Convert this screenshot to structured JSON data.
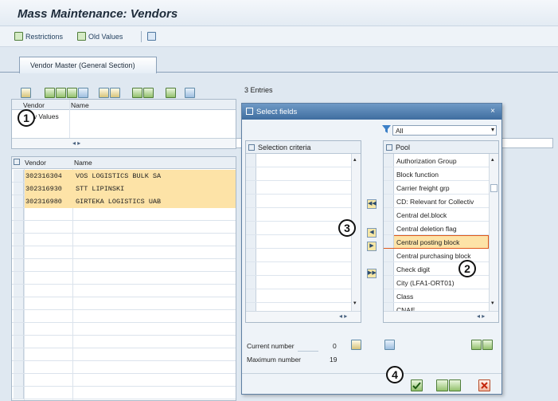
{
  "window": {
    "title": "Mass Maintenance: Vendors"
  },
  "toolbar": {
    "restrictions": "Restrictions",
    "old_values": "Old Values"
  },
  "tabs": [
    {
      "label": "Vendor Master (General Section)"
    }
  ],
  "entries_label": "3 Entries",
  "old_values_grid": {
    "col_vendor": "Vendor",
    "col_name": "Name",
    "row_label": "New Values",
    "scroll_arrows": "◂ ▸"
  },
  "vendor_grid": {
    "col_vendor": "Vendor",
    "col_name": "Name",
    "rows": [
      {
        "vendor": "302316304",
        "name": "VOS LOGISTICS BULK SA"
      },
      {
        "vendor": "302316930",
        "name": "STT LIPINSKI"
      },
      {
        "vendor": "302316980",
        "name": "GIRTEKA LOGISTICS UAB"
      }
    ]
  },
  "dialog": {
    "title": "Select fields",
    "close": "×",
    "filter_value": "All",
    "left_header": "Selection criteria",
    "right_header": "Pool",
    "pool_items": [
      "Authorization Group",
      "Block function",
      "Carrier freight grp",
      "CD: Relevant for Collectiv",
      "Central del.block",
      "Central deletion flag",
      "Central posting block",
      "Central purchasing block",
      "Check digit",
      "City (LFA1-ORT01)",
      "Class",
      "CNAE"
    ],
    "selected_pool_index": 6,
    "current_number_label": "Current number",
    "current_number": "0",
    "maximum_number_label": "Maximum number",
    "maximum_number": "19"
  },
  "callouts": [
    "1",
    "2",
    "3",
    "4"
  ],
  "colors": {
    "selection": "#fde3a7",
    "title_bar": "#3f6d9f"
  }
}
